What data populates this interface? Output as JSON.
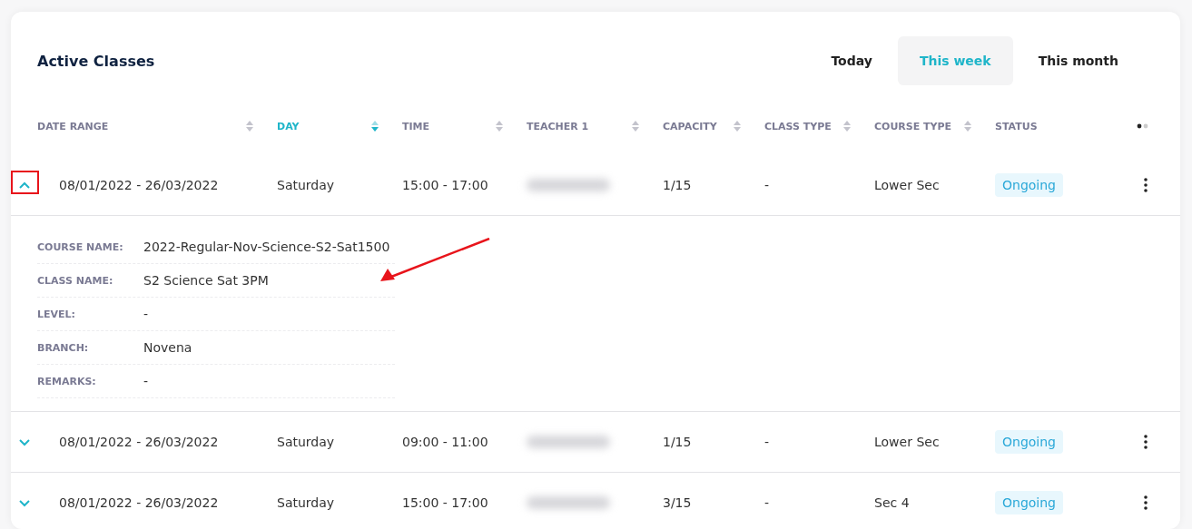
{
  "title": "Active Classes",
  "tabs": [
    {
      "label": "Today",
      "selected": false
    },
    {
      "label": "This week",
      "selected": true
    },
    {
      "label": "This month",
      "selected": false
    }
  ],
  "table": {
    "columns": [
      {
        "label": "DATE RANGE",
        "sortable": true,
        "sorted": false
      },
      {
        "label": "DAY",
        "sortable": true,
        "sorted": true
      },
      {
        "label": "TIME",
        "sortable": true,
        "sorted": false
      },
      {
        "label": "TEACHER 1",
        "sortable": true,
        "sorted": false
      },
      {
        "label": "CAPACITY",
        "sortable": true,
        "sorted": false
      },
      {
        "label": "CLASS TYPE",
        "sortable": true,
        "sorted": false
      },
      {
        "label": "COURSE TYPE",
        "sortable": true,
        "sorted": false
      },
      {
        "label": "STATUS",
        "sortable": false,
        "sorted": false
      }
    ],
    "rows": [
      {
        "expanded": true,
        "date_range": "08/01/2022 - 26/03/2022",
        "day": "Saturday",
        "time": "15:00 - 17:00",
        "capacity": "1/15",
        "class_type": "-",
        "course_type": "Lower Sec",
        "status": "Ongoing",
        "details": [
          {
            "label": "COURSE NAME:",
            "value": "2022-Regular-Nov-Science-S2-Sat1500"
          },
          {
            "label": "CLASS NAME:",
            "value": "S2 Science Sat 3PM"
          },
          {
            "label": "LEVEL:",
            "value": "-"
          },
          {
            "label": "BRANCH:",
            "value": "Novena"
          },
          {
            "label": "REMARKS:",
            "value": "-"
          }
        ]
      },
      {
        "expanded": false,
        "date_range": "08/01/2022 - 26/03/2022",
        "day": "Saturday",
        "time": "09:00 - 11:00",
        "capacity": "1/15",
        "class_type": "-",
        "course_type": "Lower Sec",
        "status": "Ongoing"
      },
      {
        "expanded": false,
        "date_range": "08/01/2022 - 26/03/2022",
        "day": "Saturday",
        "time": "15:00 - 17:00",
        "capacity": "3/15",
        "class_type": "-",
        "course_type": "Sec 4",
        "status": "Ongoing"
      }
    ]
  }
}
